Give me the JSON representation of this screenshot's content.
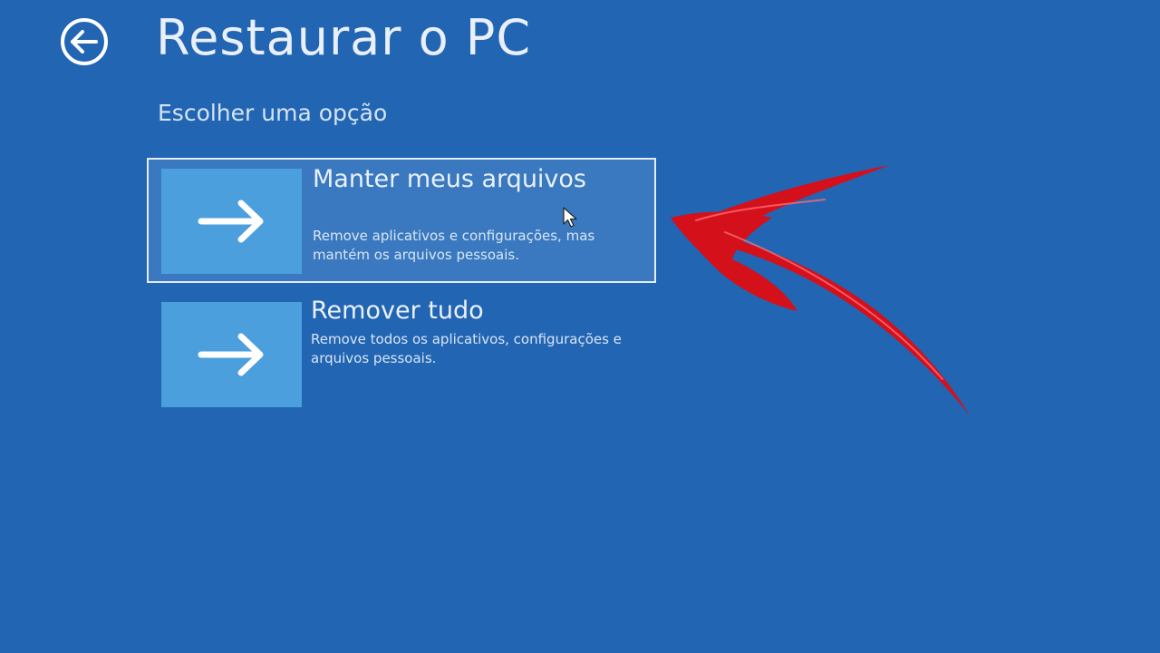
{
  "header": {
    "title": "Restaurar o PC",
    "back_icon": "back-arrow-circle-icon"
  },
  "subtitle": "Escolher uma opção",
  "options": [
    {
      "title": "Manter meus arquivos",
      "description": "Remove aplicativos e configurações, mas mantém os arquivos pessoais.",
      "icon": "arrow-right-icon",
      "selected": true
    },
    {
      "title": "Remover tudo",
      "description": "Remove todos os aplicativos, configurações e arquivos pessoais.",
      "icon": "arrow-right-icon",
      "selected": false
    }
  ],
  "colors": {
    "background": "#2265b3",
    "tile": "#4b9fdd",
    "selected_fill": "#3a79c0",
    "annotation_arrow": "#d4101b"
  }
}
